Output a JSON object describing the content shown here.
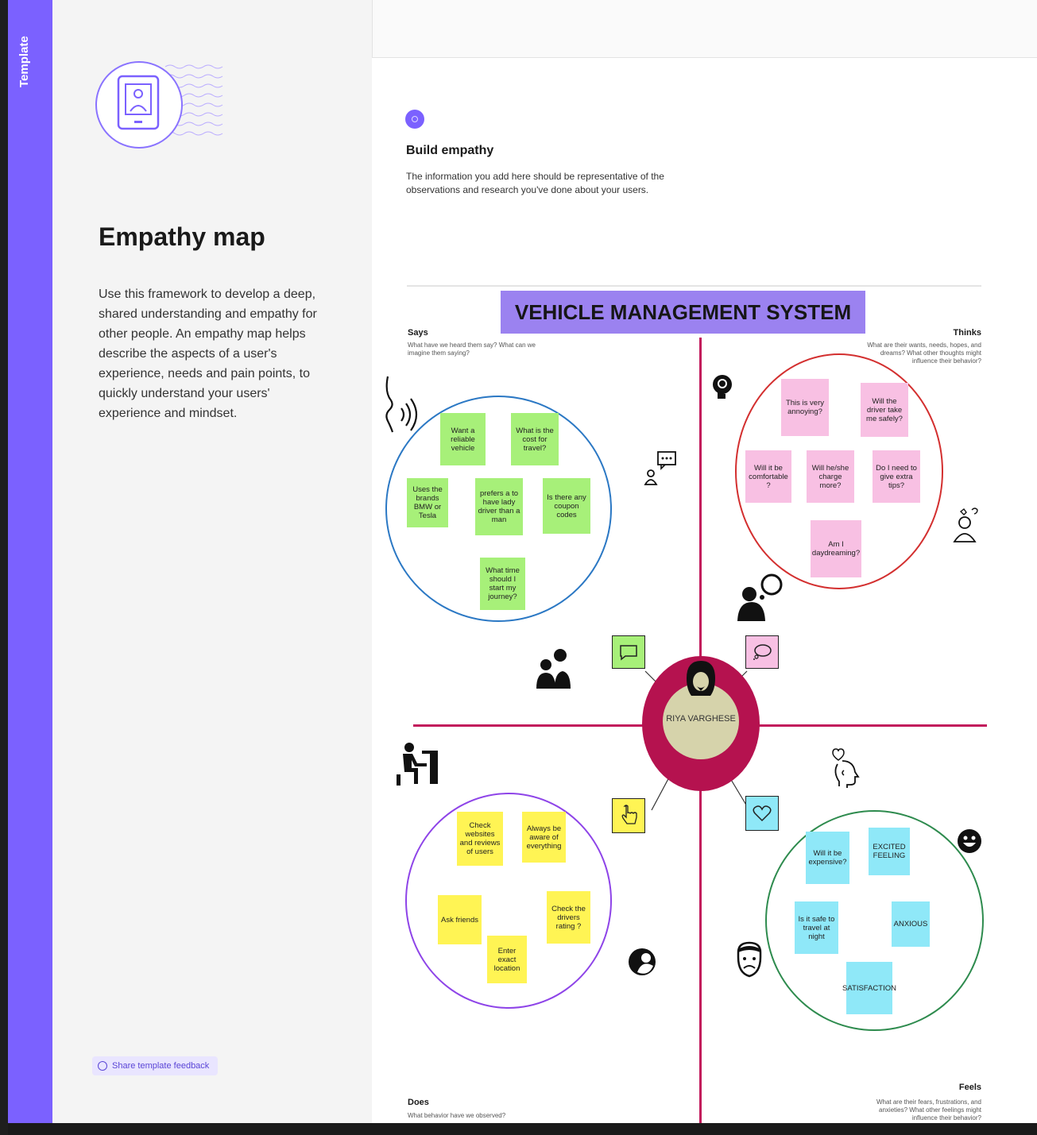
{
  "template_tab": {
    "label": "Template"
  },
  "sidebar": {
    "title": "Empathy map",
    "description": "Use this framework to develop a deep, shared understanding and empathy for other people. An empathy map helps describe the aspects of a user's experience, needs and pain points, to quickly understand your users' experience and mindset.",
    "feedback_button": "Share template feedback"
  },
  "board": {
    "section_title": "Build empathy",
    "section_desc": "The information you add here should be representative of the observations and research you've done about your users.",
    "banner": "VEHICLE MANAGEMENT SYSTEM",
    "center_name": "RIYA VARGHESE",
    "quadrants": {
      "says": {
        "title": "Says",
        "desc": "What have we heard them say? What can we imagine them saying?"
      },
      "thinks": {
        "title": "Thinks",
        "desc": "What are their wants, needs, hopes, and dreams? What other thoughts might influence their behavior?"
      },
      "does": {
        "title": "Does",
        "desc": "What behavior have we observed?"
      },
      "feels": {
        "title": "Feels",
        "desc": "What are their fears, frustrations, and anxieties? What other feelings might influence their behavior?"
      }
    },
    "says_notes": [
      "Want a reliable vehicle",
      "What is the cost for travel?",
      "Uses the brands BMW or Tesla",
      "prefers a to have lady driver than a man",
      "Is there any coupon codes",
      "What time should I start my journey?"
    ],
    "thinks_notes": [
      "This is very annoying?",
      "Will the driver take me safely?",
      "Will it be comfortable ?",
      "Will he/she charge more?",
      "Do I need to give extra tips?",
      "Am I daydreaming?"
    ],
    "does_notes": [
      "Check websites and reviews of users",
      "Always be aware of everything",
      "Ask friends",
      "Check the drivers rating ?",
      "Enter exact location"
    ],
    "feels_notes": [
      "Will it be expensive?",
      "EXCITED FEELING",
      "Is it safe to travel at night",
      "ANXIOUS",
      "SATISFACTION"
    ]
  },
  "colors": {
    "accent": "#7b61ff",
    "banner": "#9b82f0",
    "axis": "#c2185b",
    "center_outer": "#b5124f",
    "center_inner": "#d6d3ab"
  }
}
